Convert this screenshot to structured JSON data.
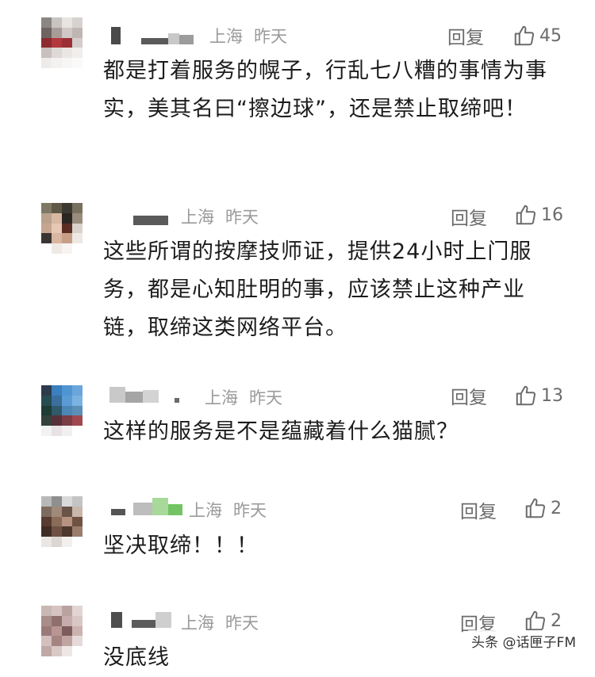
{
  "reply_label": "回复",
  "comments": [
    {
      "location": "上海",
      "time": "昨天",
      "likes": "45",
      "text": "都是打着服务的幌子，行乱七八糟的事情为事实，美其名曰“擦边球”，还是禁止取缔吧！"
    },
    {
      "location": "上海",
      "time": "昨天",
      "likes": "16",
      "text": "这些所谓的按摩技师证，提供24小时上门服务，都是心知肚明的事，应该禁止这种产业链，取缔这类网络平台。"
    },
    {
      "location": "上海",
      "time": "昨天",
      "likes": "13",
      "text": "这样的服务是不是蕴藏着什么猫腻？"
    },
    {
      "location": "上海",
      "time": "昨天",
      "likes": "2",
      "text": "坚决取缔！！！"
    },
    {
      "location": "上海",
      "time": "昨天",
      "likes": "2",
      "text": "没底线"
    }
  ],
  "watermark": "头条 @话匣子FM",
  "colors": {
    "meta_gray": "#9a9a9a",
    "action_gray": "#6b6b6b",
    "text": "#1c1c1c"
  },
  "icons": [
    "thumbs-up-icon"
  ]
}
